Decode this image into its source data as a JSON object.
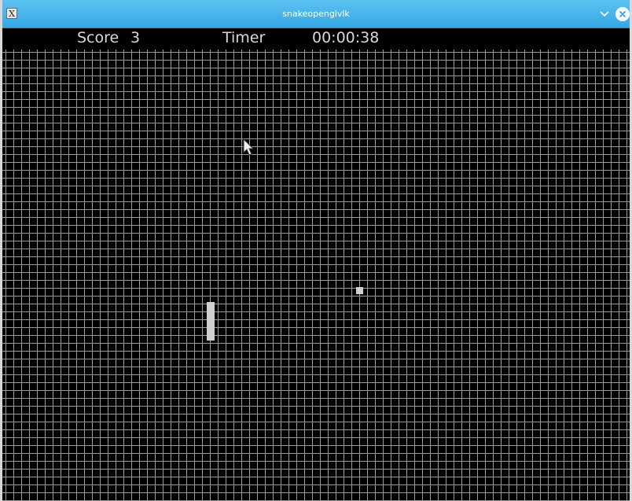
{
  "window": {
    "title": "snakeopenglvlk",
    "icon": "x-window-icon",
    "icon_glyph": "X"
  },
  "hud": {
    "score_label": "Score",
    "score_value": "3",
    "timer_label": "Timer",
    "timer_value": "00:00:38"
  },
  "colors": {
    "titlebar": "#36a7e3",
    "board_background": "#000000",
    "grid_lines": "#9a9a9a",
    "snake": "#cfcfcf",
    "food": "#cfcfcf",
    "hud_text": "#d9d9d9"
  }
}
